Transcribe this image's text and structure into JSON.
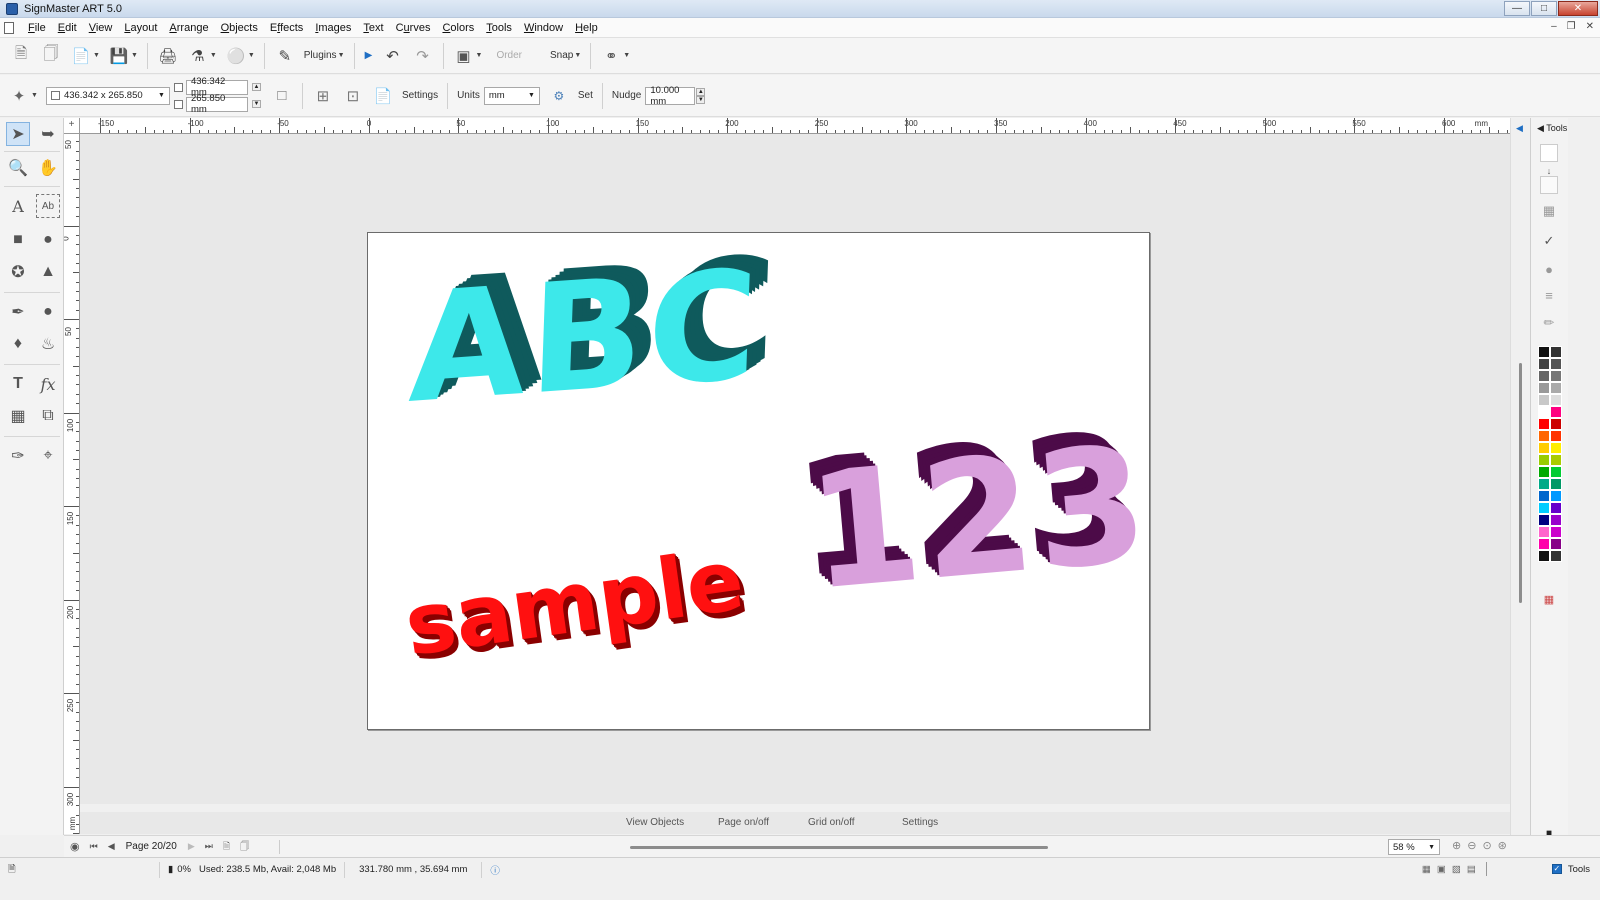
{
  "window": {
    "title": "SignMaster ART 5.0"
  },
  "menu": [
    {
      "label": "File",
      "key": "F"
    },
    {
      "label": "Edit",
      "key": "E"
    },
    {
      "label": "View",
      "key": "V"
    },
    {
      "label": "Layout",
      "key": "L"
    },
    {
      "label": "Arrange",
      "key": "A"
    },
    {
      "label": "Objects",
      "key": "O"
    },
    {
      "label": "Effects",
      "key": "f"
    },
    {
      "label": "Images",
      "key": "I"
    },
    {
      "label": "Text",
      "key": "T"
    },
    {
      "label": "Curves",
      "key": "u"
    },
    {
      "label": "Colors",
      "key": "C"
    },
    {
      "label": "Tools",
      "key": "T"
    },
    {
      "label": "Window",
      "key": "W"
    },
    {
      "label": "Help",
      "key": "H"
    }
  ],
  "toolbar": {
    "plugins_label": "Plugins",
    "order_label": "Order",
    "snap_label": "Snap"
  },
  "properties": {
    "size_value": "436.342 x 265.850",
    "width_value": "436.342 mm",
    "height_value": "265.850 mm",
    "settings_label": "Settings",
    "units_label": "Units",
    "units_value": "mm",
    "set_label": "Set",
    "nudge_label": "Nudge",
    "nudge_value": "10.000 mm"
  },
  "ruler": {
    "unit": "mm",
    "h_labels": [
      "-150",
      "-100",
      "-50",
      "0",
      "50",
      "100",
      "150",
      "200",
      "250",
      "300",
      "350",
      "400",
      "450",
      "500",
      "550",
      "600"
    ],
    "v_labels": [
      "50",
      "0",
      "50",
      "100",
      "150",
      "200",
      "250",
      "300"
    ]
  },
  "artwork": {
    "abc_text": "ABC",
    "abc_face_color": "#3de8ea",
    "abc_depth_color": "#0f5a5c",
    "num_text": "123",
    "num_face_color": "#d9a0dc",
    "num_depth_color": "#4c0b48",
    "sample_text": "sample",
    "sample_face_color": "#ff1010",
    "sample_depth_color": "#8a0000"
  },
  "canvas_links": {
    "view_objects": "View Objects",
    "page_onoff": "Page on/off",
    "grid_onoff": "Grid on/off",
    "settings": "Settings"
  },
  "navigation": {
    "page_label": "Page 20/20",
    "zoom_value": "58 %"
  },
  "status": {
    "progress": "0%",
    "memory": "Used: 238.5 Mb, Avail: 2,048 Mb",
    "coords": "331.780 mm , 35.694 mm",
    "tools_label": "Tools"
  },
  "right_panel": {
    "header": "Tools",
    "swatches": [
      "#111111",
      "#333333",
      "#444444",
      "#555555",
      "#666666",
      "#777777",
      "#999999",
      "#aaaaaa",
      "#c8c8c8",
      "#dddddd",
      "#ffffff",
      "#ff0080",
      "#ff0000",
      "#cc0000",
      "#ff6600",
      "#ff3300",
      "#ffcc00",
      "#ffee00",
      "#99cc00",
      "#aacc00",
      "#00aa00",
      "#00cc33",
      "#00aa88",
      "#009966",
      "#0066cc",
      "#0099ff",
      "#00ccff",
      "#6600cc",
      "#000080",
      "#9900cc",
      "#ff66cc",
      "#cc00cc",
      "#ff00aa",
      "#880088",
      "#111111",
      "#333333"
    ]
  }
}
